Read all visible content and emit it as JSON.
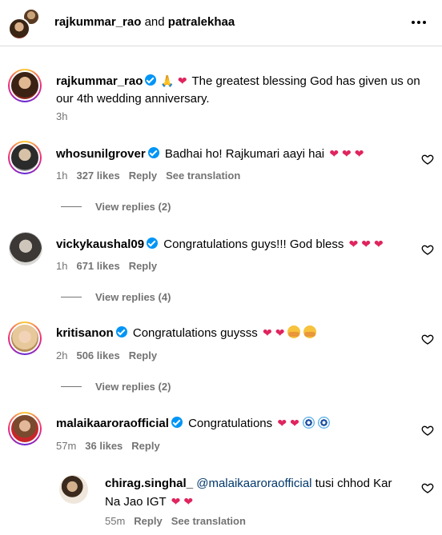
{
  "header": {
    "user1": "rajkummar_rao",
    "and": " and ",
    "user2": "patralekhaa"
  },
  "caption": {
    "username": "rajkummar_rao",
    "text_line1": "The greatest blessing God has given us on",
    "text_line2": "our 4th wedding anniversary.",
    "time": "3h"
  },
  "comments": [
    {
      "username": "whosunilgrover",
      "text": "Badhai ho! Rajkumari aayi hai",
      "time": "1h",
      "likes": "327 likes",
      "reply": "Reply",
      "translate": "See translation",
      "view_replies": "View replies (2)"
    },
    {
      "username": "vickykaushal09",
      "text": "Congratulations guys!!! God bless",
      "time": "1h",
      "likes": "671 likes",
      "reply": "Reply",
      "view_replies": "View replies (4)"
    },
    {
      "username": "kritisanon",
      "text": "Congratulations guysss",
      "time": "2h",
      "likes": "506 likes",
      "reply": "Reply",
      "view_replies": "View replies (2)"
    },
    {
      "username": "malaikaaroraofficial",
      "text": "Congratulations",
      "time": "57m",
      "likes": "36 likes",
      "reply": "Reply"
    }
  ],
  "reply": {
    "username": "chirag.singhal_",
    "mention": "@malaikaaroraofficial",
    "text_line1": "tusi chhod Kar",
    "text_line2": "Na Jao IGT",
    "time": "55m",
    "reply": "Reply",
    "translate": "See translation"
  },
  "icons": {
    "more": "more-horizontal-icon",
    "like": "heart-outline-icon",
    "verified": "verified-badge-icon"
  },
  "colors": {
    "verified": "#0095f6",
    "muted": "#737373",
    "mention": "#00376b",
    "heart": "#e0245e"
  }
}
